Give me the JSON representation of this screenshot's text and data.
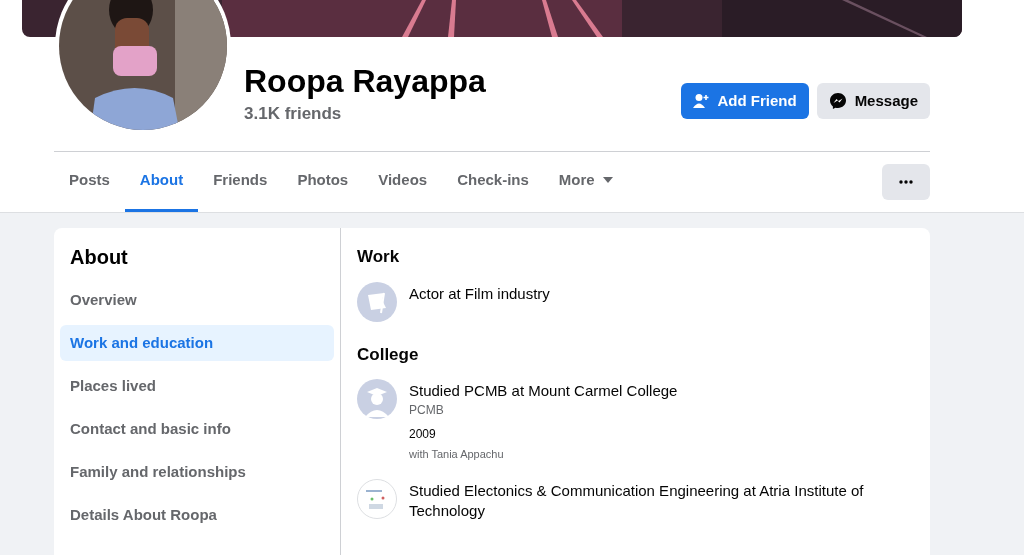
{
  "profile": {
    "name": "Roopa Rayappa",
    "friends": "3.1K friends"
  },
  "actions": [
    {
      "kind": "primary",
      "label": "Add Friend"
    },
    {
      "kind": "secondary",
      "label": "Message"
    }
  ],
  "tabs": [
    {
      "label": "Posts",
      "selected": false
    },
    {
      "label": "About",
      "selected": true
    },
    {
      "label": "Friends",
      "selected": false
    },
    {
      "label": "Photos",
      "selected": false
    },
    {
      "label": "Videos",
      "selected": false
    },
    {
      "label": "Check-ins",
      "selected": false
    },
    {
      "label": "More",
      "selected": false,
      "dropdown": true
    }
  ],
  "about": {
    "title": "About",
    "items": [
      {
        "label": "Overview",
        "selected": false
      },
      {
        "label": "Work and education",
        "selected": true
      },
      {
        "label": "Places lived",
        "selected": false
      },
      {
        "label": "Contact and basic info",
        "selected": false
      },
      {
        "label": "Family and relationships",
        "selected": false
      },
      {
        "label": "Details About Roopa",
        "selected": false
      }
    ]
  },
  "sections": [
    {
      "heading": "Work",
      "entries": [
        {
          "kind": "work",
          "title": "Actor at Film industry"
        }
      ]
    },
    {
      "heading": "College",
      "entries": [
        {
          "kind": "school",
          "title": "Studied PCMB at Mount Carmel College",
          "subtitle": "PCMB",
          "year": "2009",
          "with": "with Tania Appachu"
        },
        {
          "kind": "logo",
          "title": "Studied Electonics & Communication Engineering at Atria Institute of Technology"
        }
      ]
    }
  ]
}
